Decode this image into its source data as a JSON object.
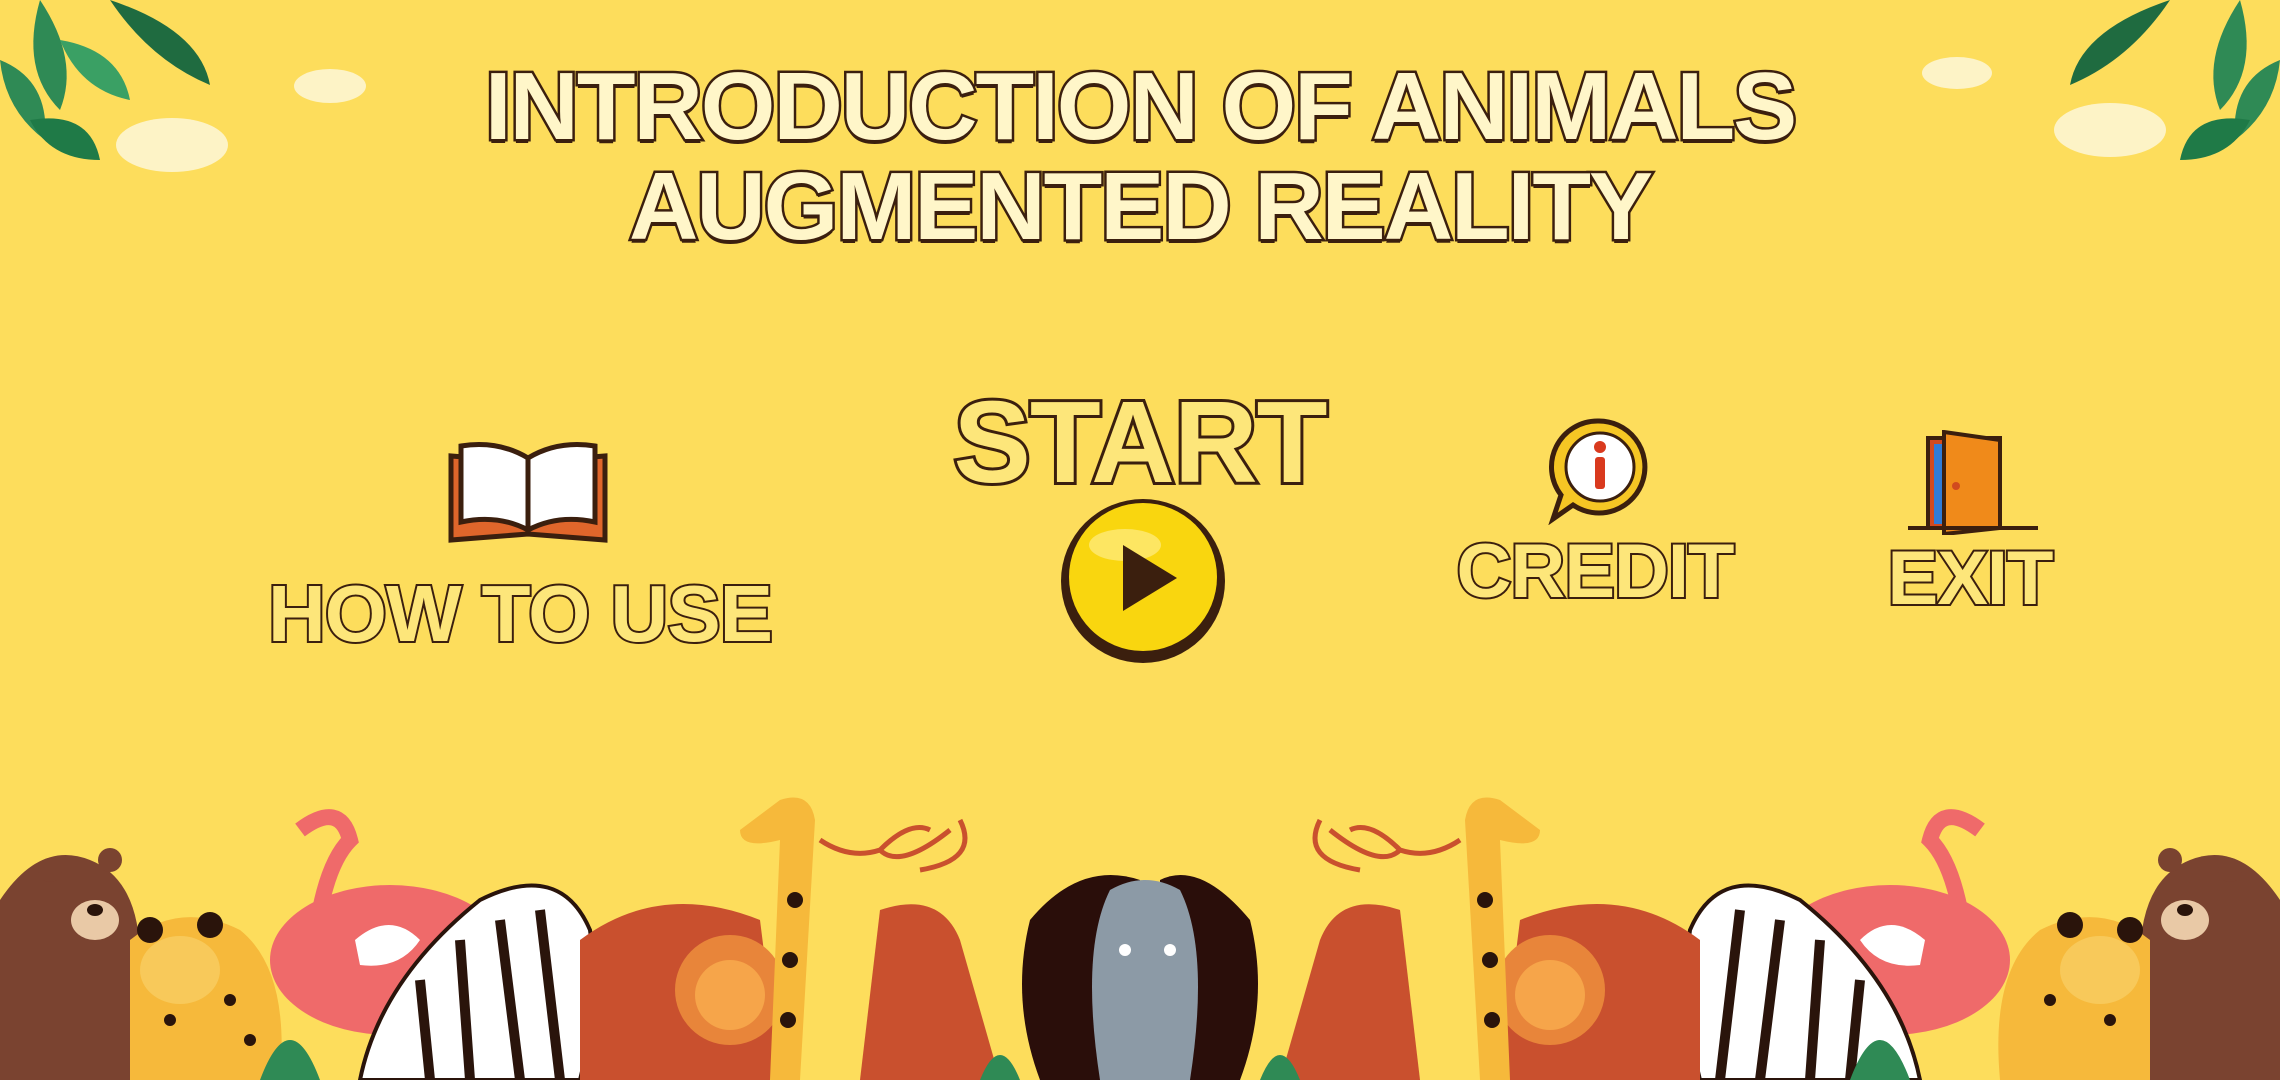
{
  "title": {
    "line1": "INTRODUCTION OF ANIMALS",
    "line2": "AUGMENTED REALITY"
  },
  "menu": {
    "how_to_use": {
      "label": "HOW TO USE",
      "icon": "open-book-icon"
    },
    "start": {
      "label": "START",
      "icon": "play-icon"
    },
    "credit": {
      "label": "CREDIT",
      "icon": "info-icon"
    },
    "exit": {
      "label": "EXIT",
      "icon": "door-icon"
    }
  },
  "colors": {
    "background": "#fddd5c",
    "outline": "#3b1f0e",
    "text_fill": "#fff6c9",
    "play_button": "#f9d60f"
  }
}
